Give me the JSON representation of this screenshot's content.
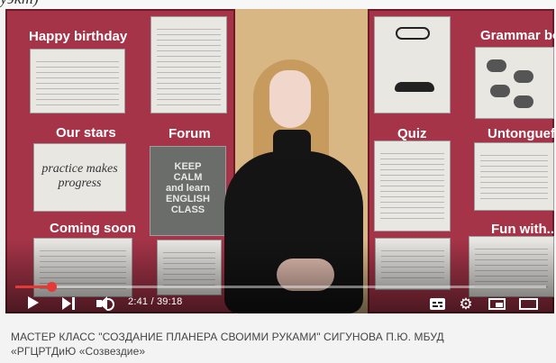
{
  "top_strip": {
    "text": "уэкт)"
  },
  "boards": {
    "happy_birthday": "Happy birthday",
    "our_stars": "Our stars",
    "forum": "Forum",
    "coming_soon": "Coming soon",
    "grammar": "Grammar bo",
    "quiz": "Quiz",
    "untongueful": "Untongueful",
    "fun_with": "Fun with..."
  },
  "posters": {
    "practice_text": "practice makes progress",
    "keep_calm_lines": [
      "KEEP",
      "CALM",
      "and learn",
      "ENGLISH",
      "CLASS"
    ]
  },
  "player": {
    "time_text": "2:41 / 39:18",
    "progress_fraction": 0.068,
    "accent_color": "#e53935"
  },
  "video_title": {
    "line1": "МАСТЕР КЛАСС \"СОЗДАНИЕ ПЛАНЕРА СВОИМИ РУКАМИ\" СИГУНОВА П.Ю. МБУД",
    "line2": "«РГЦРТДиЮ «Созвездие»"
  },
  "icons": {
    "play": "play-icon",
    "next": "next-icon",
    "volume": "volume-icon",
    "subtitles": "subtitles-icon",
    "settings": "gear-icon",
    "miniplayer": "miniplayer-icon",
    "theater": "theater-mode-icon"
  }
}
